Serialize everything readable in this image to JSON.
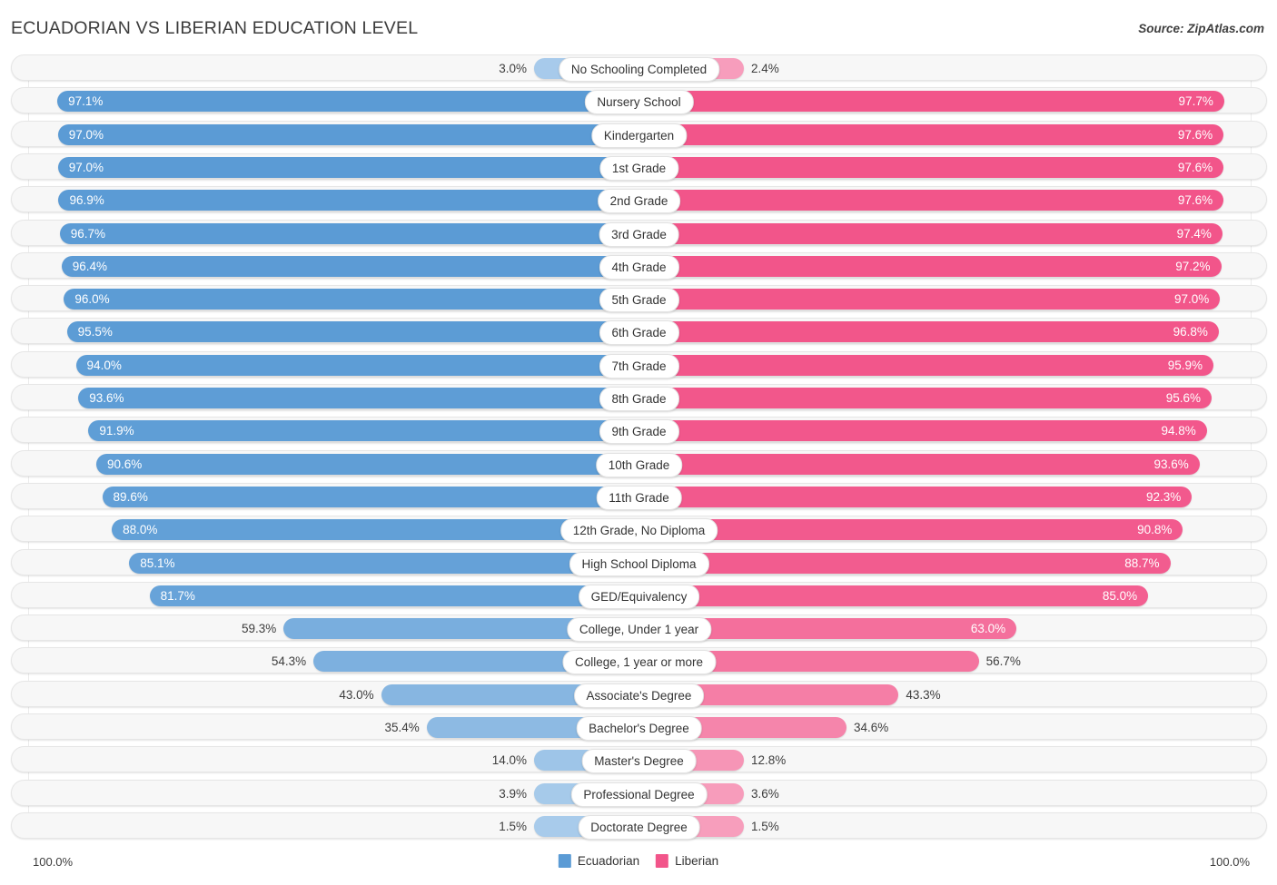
{
  "header": {
    "title": "ECUADORIAN VS LIBERIAN EDUCATION LEVEL",
    "source": "Source: ZipAtlas.com"
  },
  "footer": {
    "axis_left": "100.0%",
    "axis_right": "100.0%",
    "legend": [
      {
        "label": "Ecuadorian",
        "color": "#5b9bd5"
      },
      {
        "label": "Liberian",
        "color": "#f4traits"
      }
    ]
  },
  "colors": {
    "ecuadorian_strong": "#5b9bd5",
    "ecuadorian_light": "#a8cbeb",
    "liberian_strong": "#f2558a",
    "liberian_light": "#f79ebc",
    "track": "#f7f7f7",
    "track_border": "#e6e6e6",
    "text": "#3d3d3d"
  },
  "chart_data": {
    "type": "bar",
    "title": "ECUADORIAN VS LIBERIAN EDUCATION LEVEL",
    "subtitle": "",
    "xlabel": "",
    "ylabel": "",
    "orientation": "horizontal-diverging",
    "axis_max": 100.0,
    "axis_left_label": "100.0%",
    "axis_right_label": "100.0%",
    "legend_position": "bottom-center",
    "grid": true,
    "categories": [
      "No Schooling Completed",
      "Nursery School",
      "Kindergarten",
      "1st Grade",
      "2nd Grade",
      "3rd Grade",
      "4th Grade",
      "5th Grade",
      "6th Grade",
      "7th Grade",
      "8th Grade",
      "9th Grade",
      "10th Grade",
      "11th Grade",
      "12th Grade, No Diploma",
      "High School Diploma",
      "GED/Equivalency",
      "College, Under 1 year",
      "College, 1 year or more",
      "Associate's Degree",
      "Bachelor's Degree",
      "Master's Degree",
      "Professional Degree",
      "Doctorate Degree"
    ],
    "series": [
      {
        "name": "Ecuadorian",
        "color": "#5b9bd5",
        "values": [
          3.0,
          97.1,
          97.0,
          97.0,
          96.9,
          96.7,
          96.4,
          96.0,
          95.5,
          94.0,
          93.6,
          91.9,
          90.6,
          89.6,
          88.0,
          85.1,
          81.7,
          59.3,
          54.3,
          43.0,
          35.4,
          14.0,
          3.9,
          1.5
        ],
        "labels": [
          "3.0%",
          "97.1%",
          "97.0%",
          "97.0%",
          "96.9%",
          "96.7%",
          "96.4%",
          "96.0%",
          "95.5%",
          "94.0%",
          "93.6%",
          "91.9%",
          "90.6%",
          "89.6%",
          "88.0%",
          "85.1%",
          "81.7%",
          "59.3%",
          "54.3%",
          "43.0%",
          "35.4%",
          "14.0%",
          "3.9%",
          "1.5%"
        ]
      },
      {
        "name": "Liberian",
        "color": "#f2558a",
        "values": [
          2.4,
          97.7,
          97.6,
          97.6,
          97.6,
          97.4,
          97.2,
          97.0,
          96.8,
          95.9,
          95.6,
          94.8,
          93.6,
          92.3,
          90.8,
          88.7,
          85.0,
          63.0,
          56.7,
          43.3,
          34.6,
          12.8,
          3.6,
          1.5
        ],
        "labels": [
          "2.4%",
          "97.7%",
          "97.6%",
          "97.6%",
          "97.6%",
          "97.4%",
          "97.2%",
          "97.0%",
          "96.8%",
          "95.9%",
          "95.6%",
          "94.8%",
          "93.6%",
          "92.3%",
          "90.8%",
          "88.7%",
          "85.0%",
          "63.0%",
          "56.7%",
          "43.3%",
          "34.6%",
          "12.8%",
          "3.6%",
          "1.5%"
        ]
      }
    ]
  }
}
